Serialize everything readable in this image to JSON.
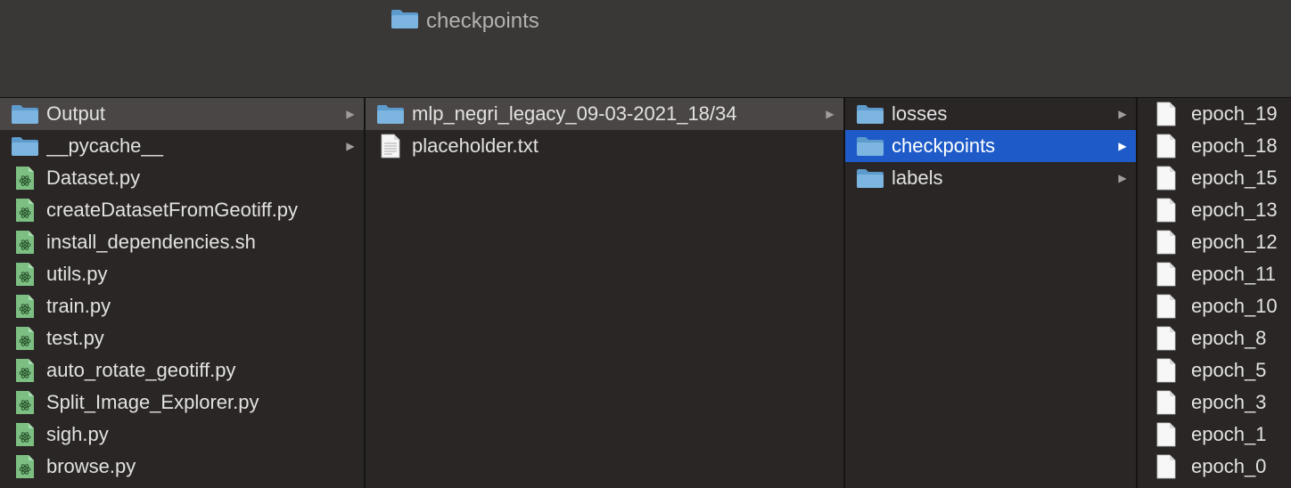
{
  "window": {
    "title": "checkpoints"
  },
  "columns": [
    {
      "items": [
        {
          "label": "Output",
          "type": "folder",
          "chevron": true,
          "state": "path"
        },
        {
          "label": "__pycache__",
          "type": "folder",
          "chevron": true,
          "state": ""
        },
        {
          "label": "Dataset.py",
          "type": "python",
          "chevron": false,
          "state": ""
        },
        {
          "label": "createDatasetFromGeotiff.py",
          "type": "python",
          "chevron": false,
          "state": ""
        },
        {
          "label": "install_dependencies.sh",
          "type": "python",
          "chevron": false,
          "state": ""
        },
        {
          "label": "utils.py",
          "type": "python",
          "chevron": false,
          "state": ""
        },
        {
          "label": "train.py",
          "type": "python",
          "chevron": false,
          "state": ""
        },
        {
          "label": "test.py",
          "type": "python",
          "chevron": false,
          "state": ""
        },
        {
          "label": "auto_rotate_geotiff.py",
          "type": "python",
          "chevron": false,
          "state": ""
        },
        {
          "label": "Split_Image_Explorer.py",
          "type": "python",
          "chevron": false,
          "state": ""
        },
        {
          "label": "sigh.py",
          "type": "python",
          "chevron": false,
          "state": ""
        },
        {
          "label": "browse.py",
          "type": "python",
          "chevron": false,
          "state": ""
        }
      ]
    },
    {
      "items": [
        {
          "label": "mlp_negri_legacy_09-03-2021_18/34",
          "type": "folder",
          "chevron": true,
          "state": "path"
        },
        {
          "label": "placeholder.txt",
          "type": "text",
          "chevron": false,
          "state": ""
        }
      ]
    },
    {
      "items": [
        {
          "label": "losses",
          "type": "folder",
          "chevron": true,
          "state": ""
        },
        {
          "label": "checkpoints",
          "type": "folder",
          "chevron": true,
          "state": "selected"
        },
        {
          "label": "labels",
          "type": "folder",
          "chevron": true,
          "state": ""
        }
      ]
    },
    {
      "items": [
        {
          "label": "epoch_19",
          "type": "file",
          "chevron": false,
          "state": ""
        },
        {
          "label": "epoch_18",
          "type": "file",
          "chevron": false,
          "state": ""
        },
        {
          "label": "epoch_15",
          "type": "file",
          "chevron": false,
          "state": ""
        },
        {
          "label": "epoch_13",
          "type": "file",
          "chevron": false,
          "state": ""
        },
        {
          "label": "epoch_12",
          "type": "file",
          "chevron": false,
          "state": ""
        },
        {
          "label": "epoch_11",
          "type": "file",
          "chevron": false,
          "state": ""
        },
        {
          "label": "epoch_10",
          "type": "file",
          "chevron": false,
          "state": ""
        },
        {
          "label": "epoch_8",
          "type": "file",
          "chevron": false,
          "state": ""
        },
        {
          "label": "epoch_5",
          "type": "file",
          "chevron": false,
          "state": ""
        },
        {
          "label": "epoch_3",
          "type": "file",
          "chevron": false,
          "state": ""
        },
        {
          "label": "epoch_1",
          "type": "file",
          "chevron": false,
          "state": ""
        },
        {
          "label": "epoch_0",
          "type": "file",
          "chevron": false,
          "state": ""
        }
      ]
    }
  ],
  "colors": {
    "selection": "#1e5bc9",
    "path_highlight": "#4a4646",
    "folder_icon": "#66aee3",
    "python_icon": "#7dbf83"
  }
}
